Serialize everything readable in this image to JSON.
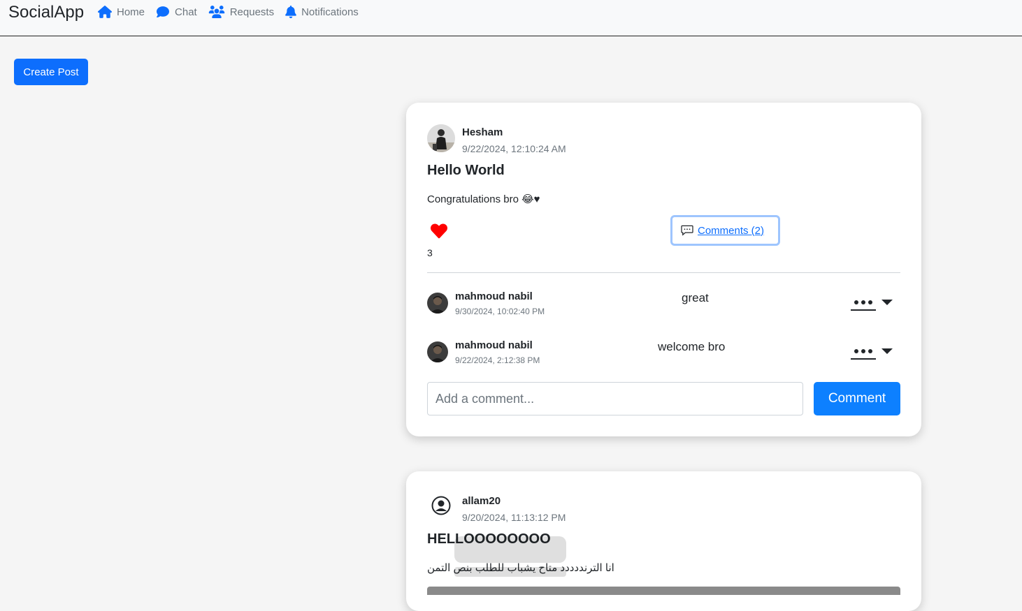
{
  "navbar": {
    "brand": "SocialApp",
    "links": [
      {
        "label": "Home",
        "icon": "home-icon"
      },
      {
        "label": "Chat",
        "icon": "chat-icon"
      },
      {
        "label": "Requests",
        "icon": "users-icon"
      },
      {
        "label": "Notifications",
        "icon": "bell-icon"
      }
    ]
  },
  "actions": {
    "create_post_label": "Create Post"
  },
  "posts": [
    {
      "author": "Hesham",
      "date": "9/22/2024, 12:10:24 AM",
      "title": "Hello World",
      "body": "Congratulations bro 😂♥",
      "likes": "3",
      "comments_label": "Comments (2)",
      "comments": [
        {
          "author": "mahmoud nabil",
          "date": "9/30/2024, 10:02:40 PM",
          "text": "great"
        },
        {
          "author": "mahmoud nabil",
          "date": "9/22/2024, 2:12:38 PM",
          "text": "welcome bro"
        }
      ],
      "comment_placeholder": "Add a comment...",
      "comment_button": "Comment"
    },
    {
      "author": "allam20",
      "date": "9/20/2024, 11:13:12 PM",
      "title": "HELLOOOOOOOO",
      "body": "انا الترنددددد متاح يشباب للطلب بنص التمن"
    }
  ],
  "colors": {
    "primary": "#0d6efd",
    "like": "#ff0000",
    "nav_bg": "#f8f9fa",
    "page_bg": "#f5f5f5"
  }
}
